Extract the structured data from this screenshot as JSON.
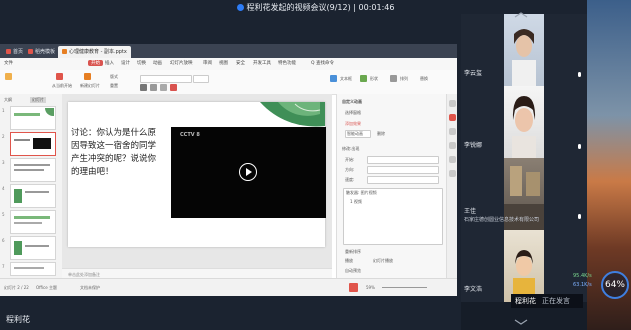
{
  "meeting": {
    "title": "程利花发起的视频会议(9/12) | 00:01:46",
    "presenter_label": "程利花",
    "speaking_toast": {
      "name": "程利花",
      "status": "正在发言"
    },
    "net": {
      "upload": "95.4K/s",
      "download": "63.1K/s",
      "percent": "64%"
    }
  },
  "wps": {
    "tabs": [
      "首页",
      "稻壳模板",
      "心理健康教育",
      "副本.pptx"
    ],
    "menu": [
      "文件",
      "开始",
      "插入",
      "设计",
      "切换",
      "动画",
      "幻灯片放映",
      "审阅",
      "视图",
      "安全",
      "开发工具",
      "特色功能",
      "Q 查找命令"
    ],
    "active_menu": "开始",
    "ribbon_labels": [
      "从当前开始",
      "新建幻灯片",
      "版式",
      "重置",
      "文本框",
      "形状",
      "排列",
      "替换"
    ],
    "thumb_pane": {
      "tabs": [
        "大纲",
        "幻灯片"
      ],
      "slide_numbers": [
        "1",
        "2",
        "3",
        "4",
        "5",
        "6",
        "7"
      ]
    },
    "slide": {
      "text": "讨论：你认为是什么原因导致这一宿舍的同学产生冲突的呢？说说你的理由吧！",
      "video_label": "CCTV 8"
    },
    "notes_placeholder": "单击此处添加备注",
    "status": {
      "slide_info": "幻灯片 2 / 22",
      "theme": "Office 主题",
      "zoom": "59%",
      "left_tools": [
        "文档未保护"
      ]
    },
    "right_pane": {
      "title": "自定义动画",
      "labels": [
        "选择窗格",
        "添加效果",
        "删除",
        "智能动画",
        "修改:出现",
        "开始:",
        "方向:",
        "速度:",
        "触发器: 图片视频",
        "1 视频",
        "重新排序",
        "播放",
        "幻灯片播放",
        "自动预览"
      ]
    }
  },
  "participants": [
    {
      "name": "李云玺",
      "org": ""
    },
    {
      "name": "李锐娜",
      "org": ""
    },
    {
      "name": "王佳",
      "org": "石家庄德创圆业信息技术有限公司"
    },
    {
      "name": "李文浩",
      "org": ""
    }
  ],
  "colors": {
    "accent": "#2d7cf6",
    "wps_active": "#d9534f",
    "dark_bg": "#1b2330"
  }
}
